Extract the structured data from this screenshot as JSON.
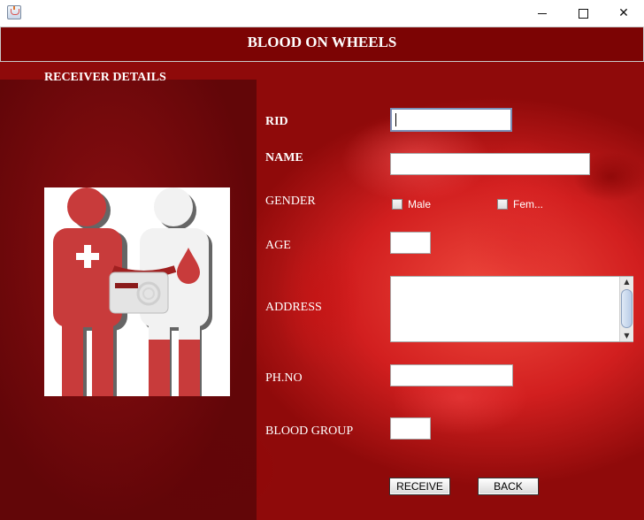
{
  "window": {
    "controls": {
      "minimize_icon": "minimize-icon",
      "maximize_icon": "maximize-icon",
      "close_icon": "close-icon",
      "close_glyph": "✕"
    }
  },
  "header": {
    "title": "BLOOD ON WHEELS"
  },
  "section": {
    "title": "RECEIVER DETAILS"
  },
  "form": {
    "rid_label": "RID",
    "rid_value": "",
    "name_label": "NAME",
    "name_value": "",
    "gender_label": "GENDER",
    "gender_options": [
      "Male",
      "Fem..."
    ],
    "age_label": "AGE",
    "age_value": "",
    "address_label": "ADDRESS",
    "address_value": "",
    "phone_label": "PH.NO",
    "phone_value": "",
    "blood_group_label": "BLOOD GROUP",
    "blood_group_value": ""
  },
  "buttons": {
    "receive": "RECEIVE",
    "back": "BACK"
  },
  "illustration": {
    "icon": "blood-transfusion-icon"
  },
  "colors": {
    "header_text": "#ffffff",
    "background": "#c81e1e",
    "donor_figure": "#c83b3b",
    "receiver_figure": "#f2f2f2"
  }
}
